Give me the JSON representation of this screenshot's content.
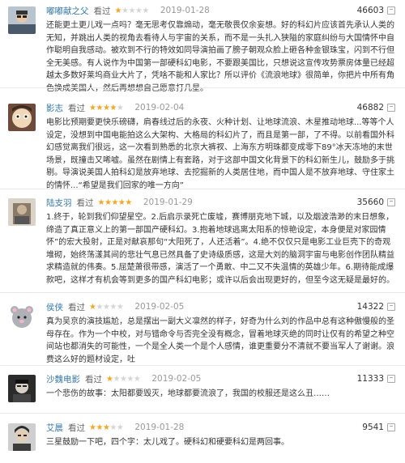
{
  "reviews": [
    {
      "user": "嘟嘟献之父",
      "action": "看过",
      "rating": 1,
      "date": "2019-01-28",
      "votes": "46603",
      "text": "还能更土更儿戏一点吗？毫无思考仅靠煽动，毫无敬畏仅余妄想。好的科幻片应该首先承认人类的无知，并跳出人类的视角去看待人与宇宙的关系，而不是一头扎入狭隘的家庭纠纷与大国情怀中自作聪明自我感动。被欢到不行的特效如同导演拍画了膀子朝观众脸上砸各种金银珠宝，闪到不行但全无美感。有人说作为中国第一部硬科幻电影，不要跟美国比，只想说这宣传攻势票房体量已经超越太多数好莱坞商业大片了，凭啥不能和人家比？所以评价《流浪地球》很简单，你把片中所有角色换成美国人，然后再想想自己愿意打几星。",
      "more": ""
    },
    {
      "user": "影志",
      "action": "看过",
      "rating": 4,
      "date": "2019-02-04",
      "votes": "46882",
      "text": "电影比预期要更快乐磅礴，肩春线过后的永夜、火种计划、让地球流浪、木星推动地球...等等个人设定，没想到中国电能拍这么大架构、大格局的科幻片了，而且是第一部，了不得。以前看国外科幻感觉离我们很远，这一次看到熟悉的北京大裤衩、上海东方明珠都变成零下89°冰天冻地的末世场景，既撞击又唏嘘。虽然在剧情上有套路，对于这部中国文化背景下的科幻新生儿，鼓励多于挑剔。导演说美国人拍科幻是放弃地球、去挖掘新的人类居住地，而中国人是不放弃地球、守住家土的情怀...“希望是我们回家的唯一方向”",
      "more": ""
    },
    {
      "user": "陆支羽",
      "action": "看过",
      "rating": 5,
      "date": "2019-01-29",
      "votes": "35660",
      "text": "1.终于，轮到我们仰望星空。2.后启示录死亡废墟，赛博朋克地下城，以及烟波浩渺的末日想象，缔造了真正意义上的第一部国产硬科幻。3.抱着地球逃离太阳系的惊艳设定，本身便是对家园情怀”的宏大投射，正是对献哀那句“大阳死了，人还活着”。4.绝不仅仅只是电影工业巨壳下的奇观堆砌，始终荡漾其间的悲壮气息已然具备了史诗级质感，这是大刘的脑洞宇宙与电影创作团队精益求精造就的伟奏。5.屈楚萧很带感，演活了一个勇敢、中二又不失温情的英雄少年。6.期待能成爆款吧，这样才有机会等到更多的国产科幻电影；或许以后会出现更好的，但至今这无疑是最好的。",
      "more": ""
    },
    {
      "user": "侯侠",
      "action": "看过",
      "rating": 1,
      "date": "2019-02-05",
      "votes": "14322",
      "text": "真为吴京的演技尴尬，总是摆出一副大义凛然的样子，好奇为什么刘的作品中总有这种傲慢般的圣母存在。作为一个中校，对与错命令与否完全没有概念，冒着地球灭绝的同时让仅有的希望之种空间站也都消失的可能性，一个是全人类一个是个人感情，谁更重要分不清就不要当军人了谢谢。浪费这么好的题材设定，吐",
      "more": ""
    },
    {
      "user": "沙魏电影",
      "action": "看过",
      "rating": 1,
      "date": "2019-02-05",
      "votes": "11333",
      "text": "一个悲伤的故事：太阳都要毁灭，地球都要流浪了，我国的校服还是这么丑……",
      "more": ""
    },
    {
      "user": "艾晨",
      "action": "看过",
      "rating": 3,
      "date": "2019-01-28",
      "votes": "9541",
      "text": "三星鼓励一下吧，四个字：太儿戏了。硬科幻和硬要科幻是两回事。",
      "more": ""
    }
  ],
  "colors": {
    "username": "#3377aa",
    "star_on": "#f5a623",
    "star_off": "#d5d5d5",
    "date": "#999999"
  },
  "icons": {
    "star": "star-icon",
    "useful": "thumb-up-icon"
  }
}
